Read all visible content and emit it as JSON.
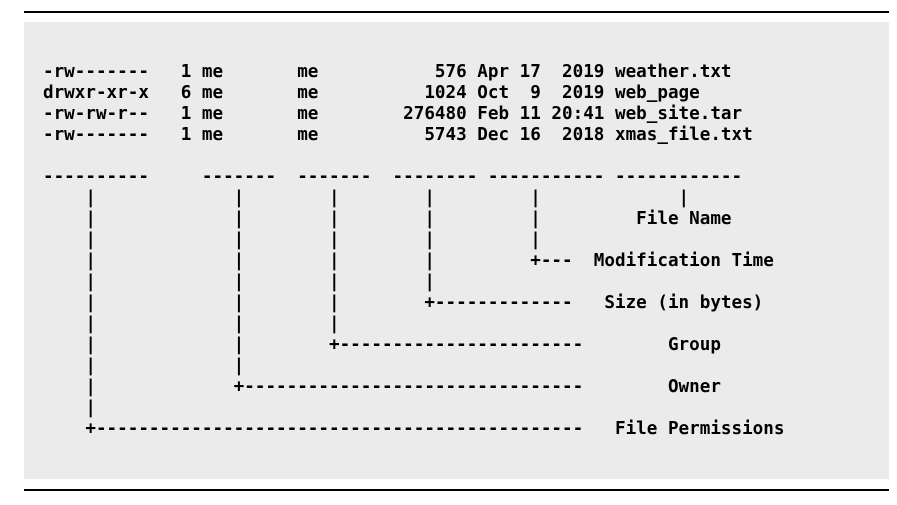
{
  "listing": {
    "files": [
      "-rw-------   1 me       me           576 Apr 17  2019 weather.txt",
      "drwxr-xr-x   6 me       me          1024 Oct  9  2019 web_page",
      "-rw-rw-r--   1 me       me        276480 Feb 11 20:41 web_site.tar",
      "-rw-------   1 me       me          5743 Dec 16  2018 xmas_file.txt"
    ],
    "separator": "----------     -------  -------  -------- ----------- ------------",
    "diagram": [
      "    |             |        |        |         |             |",
      "    |             |        |        |         |         File Name",
      "    |             |        |        |         |",
      "    |             |        |        |         +---  Modification Time",
      "    |             |        |        |",
      "    |             |        |        +-------------   Size (in bytes)",
      "    |             |        |",
      "    |             |        +-----------------------        Group",
      "    |             |",
      "    |             +--------------------------------        Owner",
      "    |",
      "    +----------------------------------------------   File Permissions"
    ]
  }
}
